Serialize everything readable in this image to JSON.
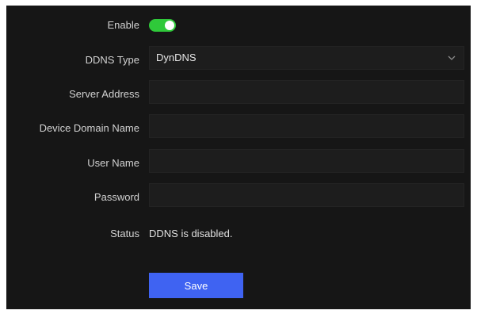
{
  "form": {
    "enable_label": "Enable",
    "enable_state": "on",
    "ddns_type_label": "DDNS Type",
    "ddns_type_value": "DynDNS",
    "server_address_label": "Server Address",
    "server_address_value": "",
    "device_domain_label": "Device Domain Name",
    "device_domain_value": "",
    "user_name_label": "User Name",
    "user_name_value": "",
    "password_label": "Password",
    "password_value": "",
    "status_label": "Status",
    "status_value": "DDNS is disabled.",
    "save_label": "Save"
  },
  "colors": {
    "panel_bg": "#161616",
    "toggle_on": "#2fc93a",
    "button_bg": "#3f63f2"
  }
}
